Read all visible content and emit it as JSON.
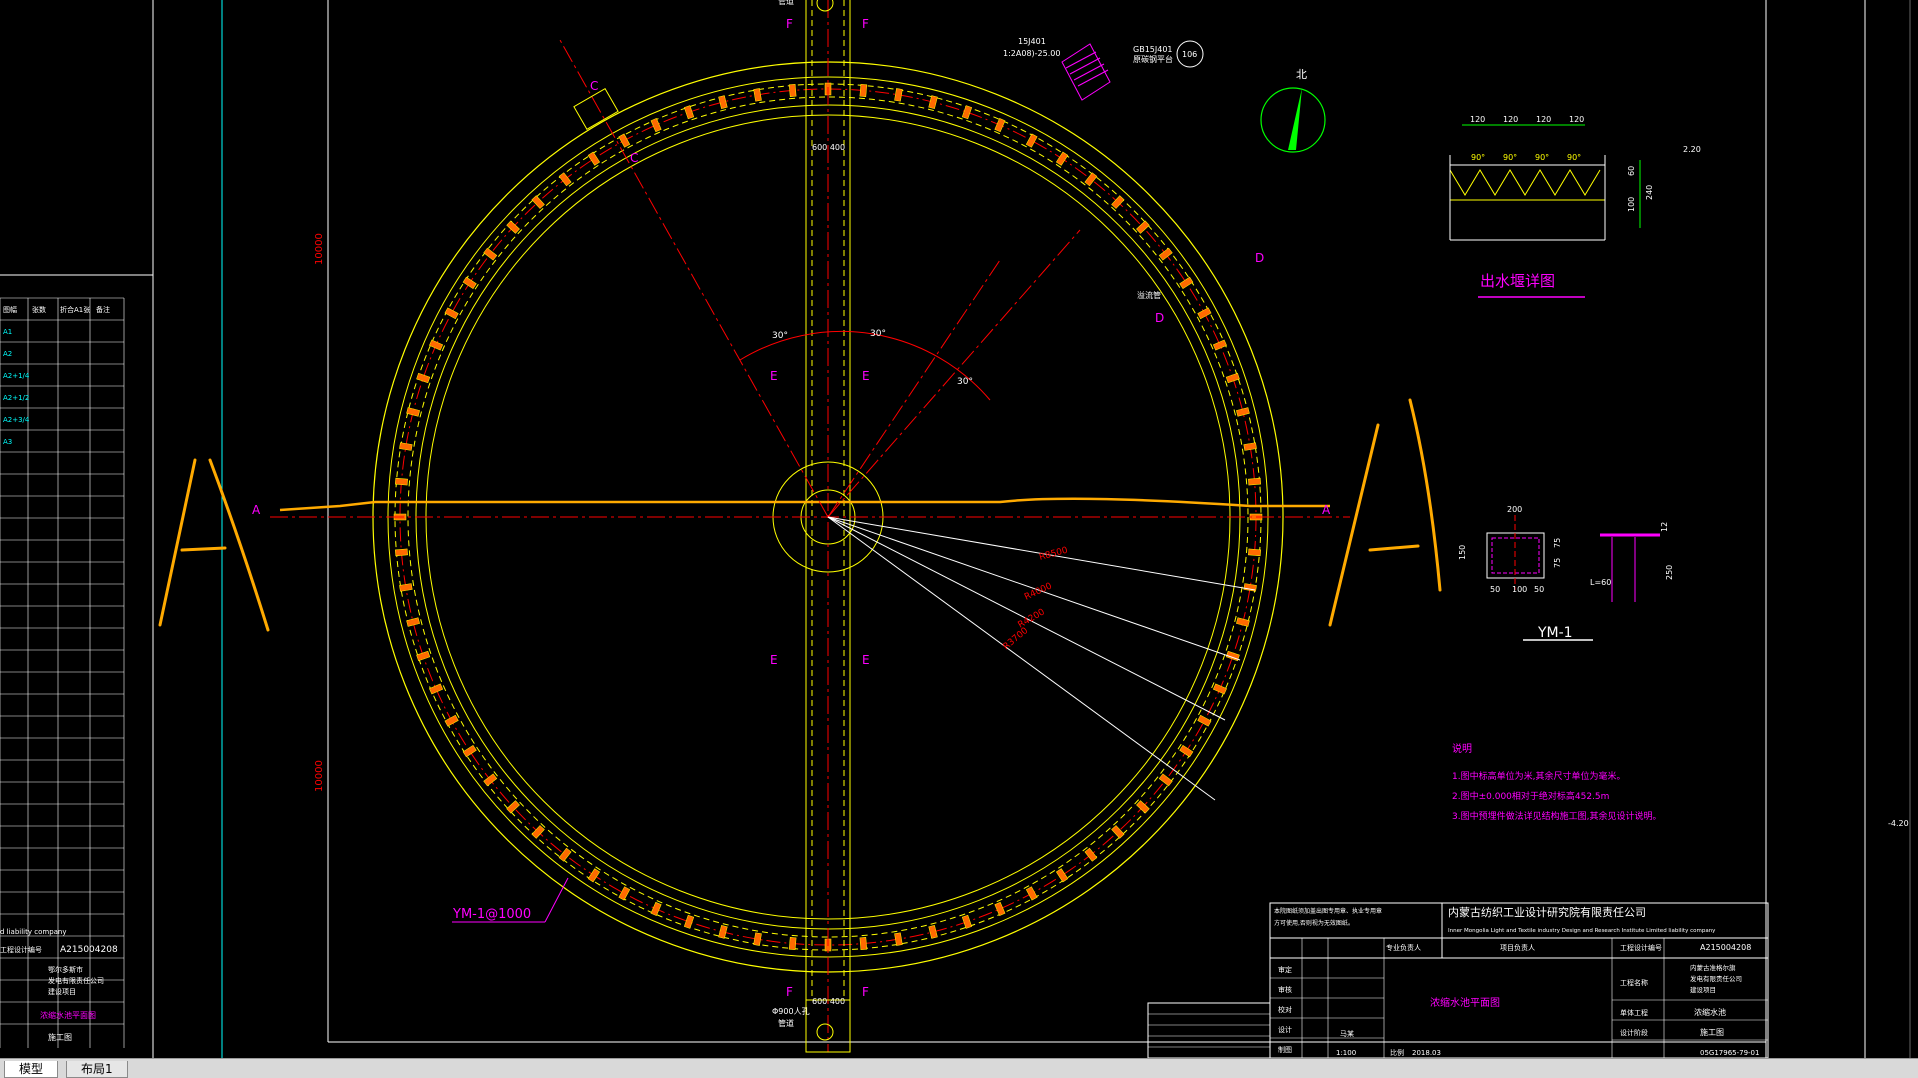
{
  "tabs": [
    "模型",
    "布局1"
  ],
  "colors": {
    "background": "#000000",
    "yellow": "#ffff00",
    "orange": "#ffaa00",
    "red": "#ff0000",
    "magenta": "#ff00ff",
    "white": "#ffffff",
    "green": "#00ff00",
    "cyan": "#00ffff"
  },
  "drawing": {
    "angle_marks": [
      "30°",
      "30°",
      "30°"
    ],
    "radius_labels": [
      "R8500",
      "R4000",
      "R4200",
      "R3700"
    ],
    "section_marks": [
      "A",
      "A",
      "C",
      "C",
      "D",
      "D",
      "E",
      "E",
      "E",
      "E",
      "F",
      "F",
      "F",
      "F"
    ],
    "dim_vertical": [
      "10000",
      "10000"
    ],
    "dim_pipe_top": "600 400",
    "dim_pipe_bottom": "600 400",
    "ym_label": "YM-1@1000",
    "top_note_left": [
      "15J401",
      "1:2A08)-25.00"
    ],
    "top_note_right": [
      "GB15J401",
      "原碳钢平台"
    ],
    "top_note_circle": "106",
    "north_label": "北",
    "leader_note": "溢流管",
    "bottom_note": [
      "Φ900人孔",
      "管道"
    ],
    "weir_title": "出水堰详图",
    "weir_dims": [
      "120",
      "120",
      "120",
      "120"
    ],
    "weir_angles": [
      "90°",
      "90°",
      "90°",
      "90°"
    ],
    "weir_side_dims": [
      "60",
      "240",
      "100"
    ],
    "weir_level": "2.20",
    "ym_detail_title": "YM-1",
    "ym_dims_top": "200",
    "ym_dims_bottom": [
      "50",
      "100",
      "50"
    ],
    "ym_dims_side": [
      "150",
      "75",
      "75"
    ],
    "ym_right_dims": [
      "12",
      "250"
    ],
    "ym_right_label": "L=60",
    "notes_title": "说明",
    "notes": [
      "1.图中标高单位为米,其余尺寸单位为毫米。",
      "2.图中±0.000相对于绝对标高452.5m",
      "3.图中预埋件做法详见结构施工图,其余见设计说明。"
    ],
    "right_level": "-4.20"
  },
  "left_table": {
    "headers": [
      "图幅",
      "张数",
      "折合A1张",
      "备注"
    ],
    "rows": [
      "A1",
      "A2",
      "A2+1/4",
      "A2+1/2",
      "A2+3/4",
      "A3"
    ],
    "company_en": "d liability company",
    "project_no_label": "工程设计编号",
    "project_no": "A215004208",
    "project_name": [
      "鄂尔多斯市",
      "发电有限责任公司",
      "建设项目"
    ],
    "drawing_name": "浓缩水池平面图",
    "stage": "施工图"
  },
  "title_block": {
    "company_cn": "内蒙古纺织工业设计研究院有限责任公司",
    "company_en": "Inner Mongolia Light and Textile industry Design and Research Institute Limited liability company",
    "warning": [
      "本院图纸须加盖出图专用章、执业专用章",
      "方可使用,否则视为无效图纸。"
    ],
    "project_no_label": "工程设计编号",
    "project_no": "A215004208",
    "project_label": "工程名称",
    "project_name": [
      "内蒙古准格尔旗",
      "发电有限责任公司",
      "建设项目"
    ],
    "item_label": "单体工程",
    "item": "浓缩水池",
    "stage_label": "设计阶段",
    "stage": "施工图",
    "drawing_title": "浓缩水池平面图",
    "rows": [
      "审定",
      "审核",
      "校对",
      "设计",
      "制图",
      "专业"
    ],
    "pro_lead": "专业负责人",
    "proj_lead": "项目负责人",
    "scale_label": "比例",
    "scale": "1:100",
    "date_label": "日期",
    "date": "2018.03",
    "drawing_no": "05G17965-79-01",
    "person": "马某"
  }
}
